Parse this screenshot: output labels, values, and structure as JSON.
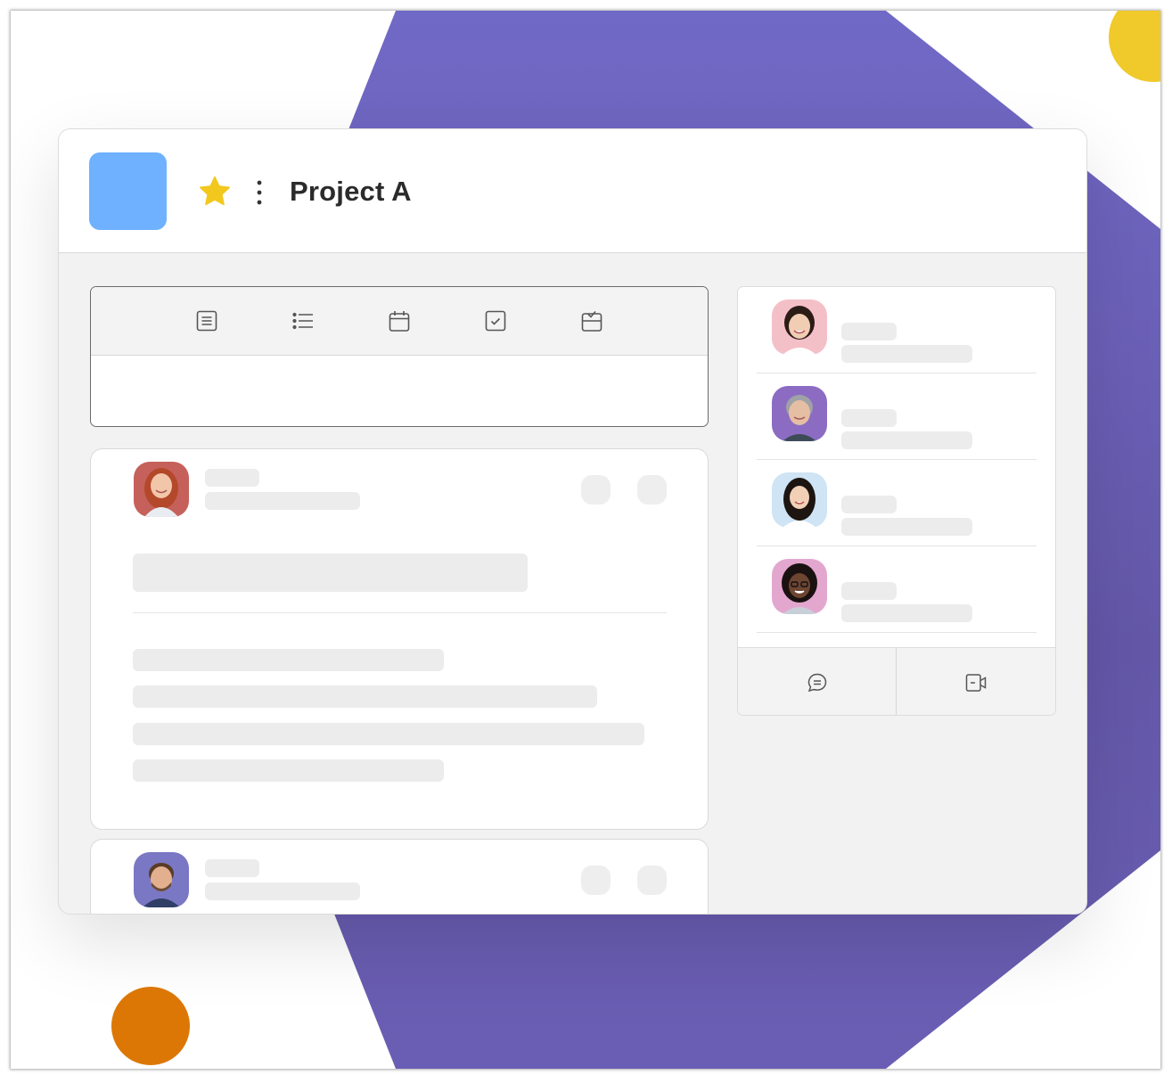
{
  "project": {
    "title": "Project A",
    "app_color": "#6fb1ff",
    "favorite_icon": "star-icon",
    "favorite_color": "#f2c81e",
    "menu_icon": "kebab-menu-icon"
  },
  "composer": {
    "tools": [
      "note-icon",
      "list-icon",
      "calendar-icon",
      "checkbox-icon",
      "inbox-icon"
    ]
  },
  "feed": {
    "posts": [
      {
        "avatar": "avatar-woman-red-hair",
        "actions": [
          "reaction-button",
          "more-button"
        ]
      },
      {
        "avatar": "avatar-man-beard",
        "actions": [
          "reaction-button",
          "more-button"
        ]
      }
    ]
  },
  "members": {
    "avatars": [
      "avatar-woman-smiling",
      "avatar-older-woman",
      "avatar-young-woman",
      "avatar-woman-glasses"
    ],
    "actions": [
      "chat-icon",
      "video-call-icon"
    ]
  },
  "decor": {
    "background_shape": "#6f67c4",
    "yellow": "#f0c92b",
    "orange": "#dc7705"
  }
}
